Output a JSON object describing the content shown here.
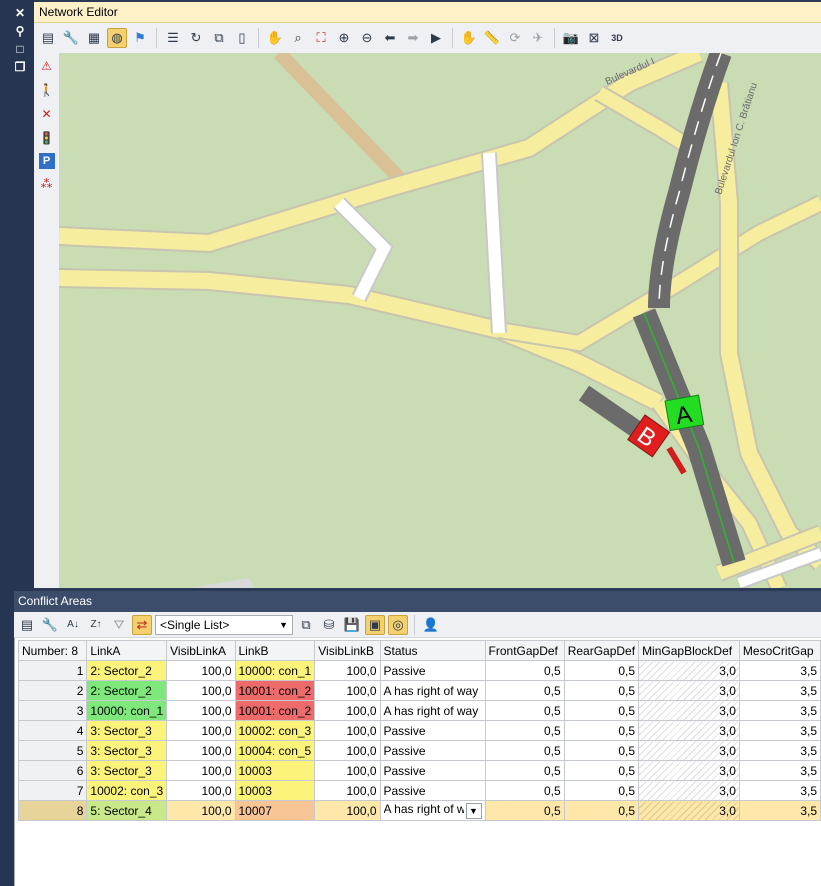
{
  "network_editor": {
    "title": "Network Editor",
    "toolbar_icons": [
      "layout-icon",
      "wrench-icon",
      "grid-icon",
      "globe-icon",
      "location-pin-icon",
      "list-icon",
      "rotate-icon",
      "copy-icon",
      "clipboard-icon",
      "hand-zoom-icon",
      "zoom-search-icon",
      "fit-window-icon",
      "zoom-in-icon",
      "zoom-out-icon",
      "back-arrow-icon",
      "forward-arrow-icon",
      "camera-video-icon",
      "pan-hand-icon",
      "measure-icon",
      "rotate-3d-icon",
      "fly-icon",
      "screenshot-icon",
      "no-wireframe-icon",
      "3d-icon"
    ],
    "sidebar_icons": [
      "warning-sign-icon",
      "pedestrian-signal-icon",
      "conflict-icon",
      "vehicle-signal-icon",
      "parking-icon",
      "network-graph-icon"
    ],
    "street_labels": [
      "Bulevardul I",
      "Bulevardul Ion C. Brătianu"
    ],
    "marker_a": "A",
    "marker_b": "B"
  },
  "conflict_areas": {
    "title": "Conflict Areas",
    "list_select": "<Single List>",
    "columns": [
      "Number: 8",
      "LinkA",
      "VisibLinkA",
      "LinkB",
      "VisibLinkB",
      "Status",
      "FrontGapDef",
      "RearGapDef",
      "MinGapBlockDef",
      "MesoCritGap"
    ],
    "rows": [
      {
        "no": "1",
        "linkA": "2: Sector_2",
        "visA": "100,0",
        "linkB": "10000: con_1",
        "visB": "100,0",
        "status": "Passive",
        "front": "0,5",
        "rear": "0,5",
        "minGap": "3,0",
        "meso": "3,5"
      },
      {
        "no": "2",
        "linkA": "2: Sector_2",
        "visA": "100,0",
        "linkB": "10001: con_2",
        "visB": "100,0",
        "status": "A has right of way",
        "front": "0,5",
        "rear": "0,5",
        "minGap": "3,0",
        "meso": "3,5"
      },
      {
        "no": "3",
        "linkA": "10000: con_1",
        "visA": "100,0",
        "linkB": "10001: con_2",
        "visB": "100,0",
        "status": "A has right of way",
        "front": "0,5",
        "rear": "0,5",
        "minGap": "3,0",
        "meso": "3,5"
      },
      {
        "no": "4",
        "linkA": "3: Sector_3",
        "visA": "100,0",
        "linkB": "10002: con_3",
        "visB": "100,0",
        "status": "Passive",
        "front": "0,5",
        "rear": "0,5",
        "minGap": "3,0",
        "meso": "3,5"
      },
      {
        "no": "5",
        "linkA": "3: Sector_3",
        "visA": "100,0",
        "linkB": "10004: con_5",
        "visB": "100,0",
        "status": "Passive",
        "front": "0,5",
        "rear": "0,5",
        "minGap": "3,0",
        "meso": "3,5"
      },
      {
        "no": "6",
        "linkA": "3: Sector_3",
        "visA": "100,0",
        "linkB": "10003",
        "visB": "100,0",
        "status": "Passive",
        "front": "0,5",
        "rear": "0,5",
        "minGap": "3,0",
        "meso": "3,5"
      },
      {
        "no": "7",
        "linkA": "10002: con_3",
        "visA": "100,0",
        "linkB": "10003",
        "visB": "100,0",
        "status": "Passive",
        "front": "0,5",
        "rear": "0,5",
        "minGap": "3,0",
        "meso": "3,5"
      },
      {
        "no": "8",
        "linkA": "5: Sector_4",
        "visA": "100,0",
        "linkB": "10007",
        "visB": "100,0",
        "status": "A has right of way",
        "front": "0,5",
        "rear": "0,5",
        "minGap": "3,0",
        "meso": "3,5"
      }
    ]
  },
  "colors": {
    "map_background": "#c9dcb4",
    "road_major": "#f6ee9e",
    "link_yellow": "#fbf37a",
    "link_green": "#7ee87a",
    "link_red": "#ee6b6b",
    "link_orange": "#f8c596",
    "selected_row": "#fde7a9"
  }
}
